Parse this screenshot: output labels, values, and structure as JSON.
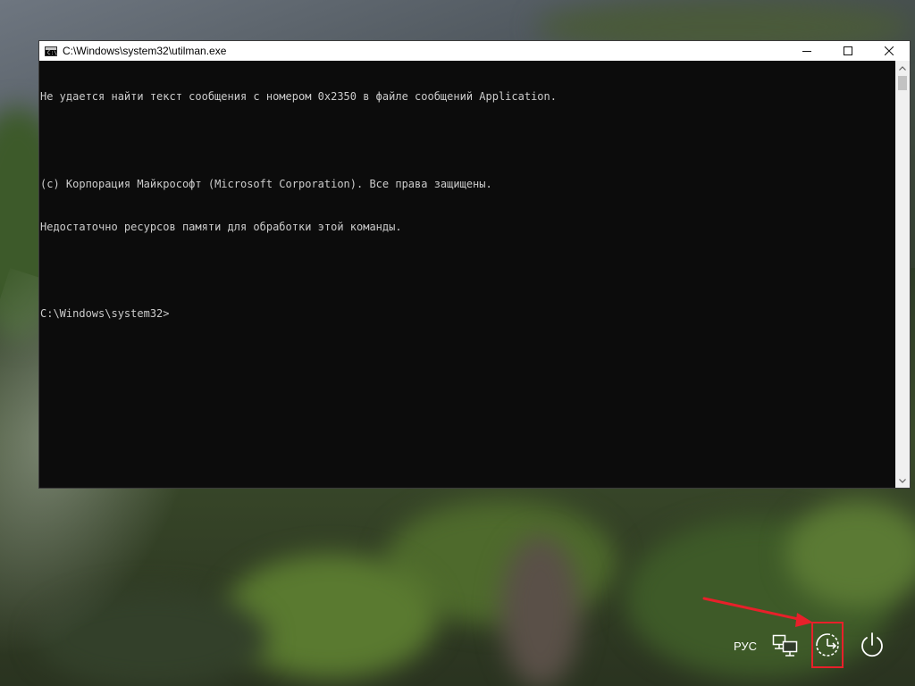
{
  "window": {
    "title": "C:\\Windows\\system32\\utilman.exe",
    "icon": "console-icon",
    "icon_glyph": "C:\\",
    "controls": {
      "minimize": "minimize-icon",
      "maximize": "maximize-icon",
      "close": "close-icon"
    }
  },
  "console": {
    "lines": [
      "Не удается найти текст сообщения с номером 0x2350 в файле сообщений Application.",
      "",
      "(c) Корпорация Майкрософт (Microsoft Corporation). Все права защищены.",
      "Недостаточно ресурсов памяти для обработки этой команды.",
      "",
      "C:\\Windows\\system32>"
    ],
    "text_color": "#cccccc",
    "background": "#0c0c0c"
  },
  "tray": {
    "language": "РУС",
    "network_icon": "network-icon",
    "ease_of_access_icon": "ease-of-access-icon",
    "power_icon": "power-icon",
    "highlight_color": "#e8202a"
  }
}
